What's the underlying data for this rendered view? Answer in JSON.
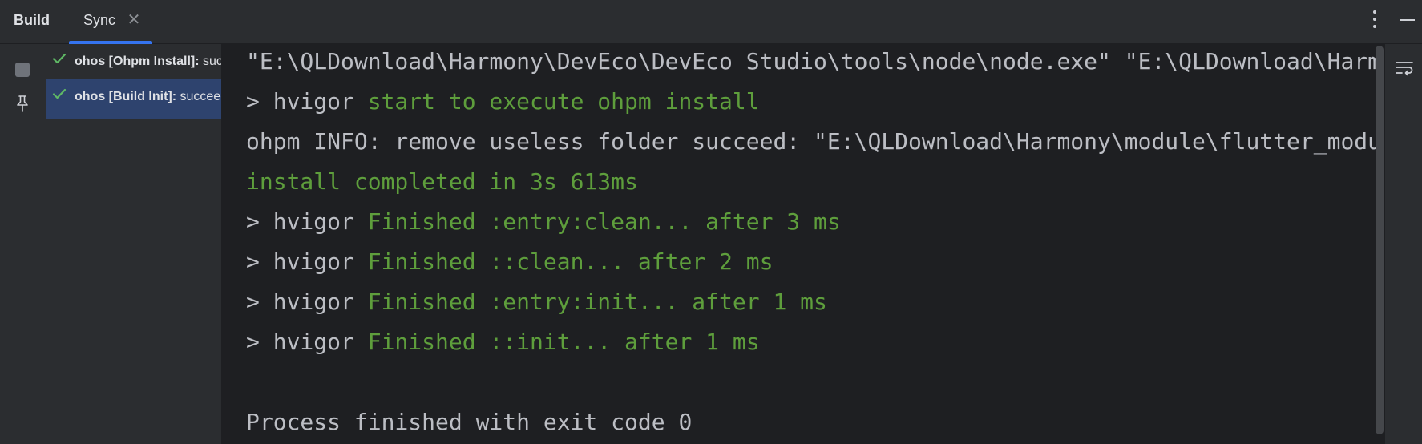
{
  "header": {
    "tool_title": "Build",
    "tab": {
      "label": "Sync",
      "close_glyph": "✕",
      "active": true
    },
    "accent_color": "#3574f0"
  },
  "toolbar": {
    "more_icon": "vertical-ellipsis-icon",
    "minimize_icon": "minimize-icon",
    "stop_icon": "stop-icon",
    "pin_icon": "pin-icon",
    "soft_wrap_icon": "soft-wrap-icon"
  },
  "build_tree": {
    "items": [
      {
        "title": "ohos [Ohpm Install]:",
        "status": "succeeded",
        "status_icon": "check-icon",
        "selected": false
      },
      {
        "title": "ohos [Build Init]:",
        "status": "succeeded",
        "status_icon": "check-icon",
        "selected": true
      }
    ]
  },
  "console": {
    "colors": {
      "default": "#bcbec4",
      "success": "#5e9e3c"
    },
    "lines": [
      {
        "plain": "\"E:\\QLDownload\\Harmony\\DevEco\\DevEco Studio\\tools\\node\\node.exe\" \"E:\\QLDownload\\Harmony\\DevEco\\DevEco Studio\\tools\\hvigor\\bin\\hvigorw.js\"",
        "green": ""
      },
      {
        "plain": "> hvigor ",
        "green": "start to execute ohpm install"
      },
      {
        "plain": "ohpm INFO: remove useless folder succeed: \"E:\\QLDownload\\Harmony\\module\\flutter_module\\.ohos\\oh_modules\"",
        "green": ""
      },
      {
        "plain": "",
        "green": "install completed in 3s 613ms"
      },
      {
        "plain": "> hvigor ",
        "green": "Finished :entry:clean... after 3 ms"
      },
      {
        "plain": "> hvigor ",
        "green": "Finished ::clean... after 2 ms"
      },
      {
        "plain": "> hvigor ",
        "green": "Finished :entry:init... after 1 ms"
      },
      {
        "plain": "> hvigor ",
        "green": "Finished ::init... after 1 ms"
      },
      {
        "plain": "",
        "green": ""
      },
      {
        "plain": "Process finished with exit code 0",
        "green": ""
      }
    ]
  }
}
